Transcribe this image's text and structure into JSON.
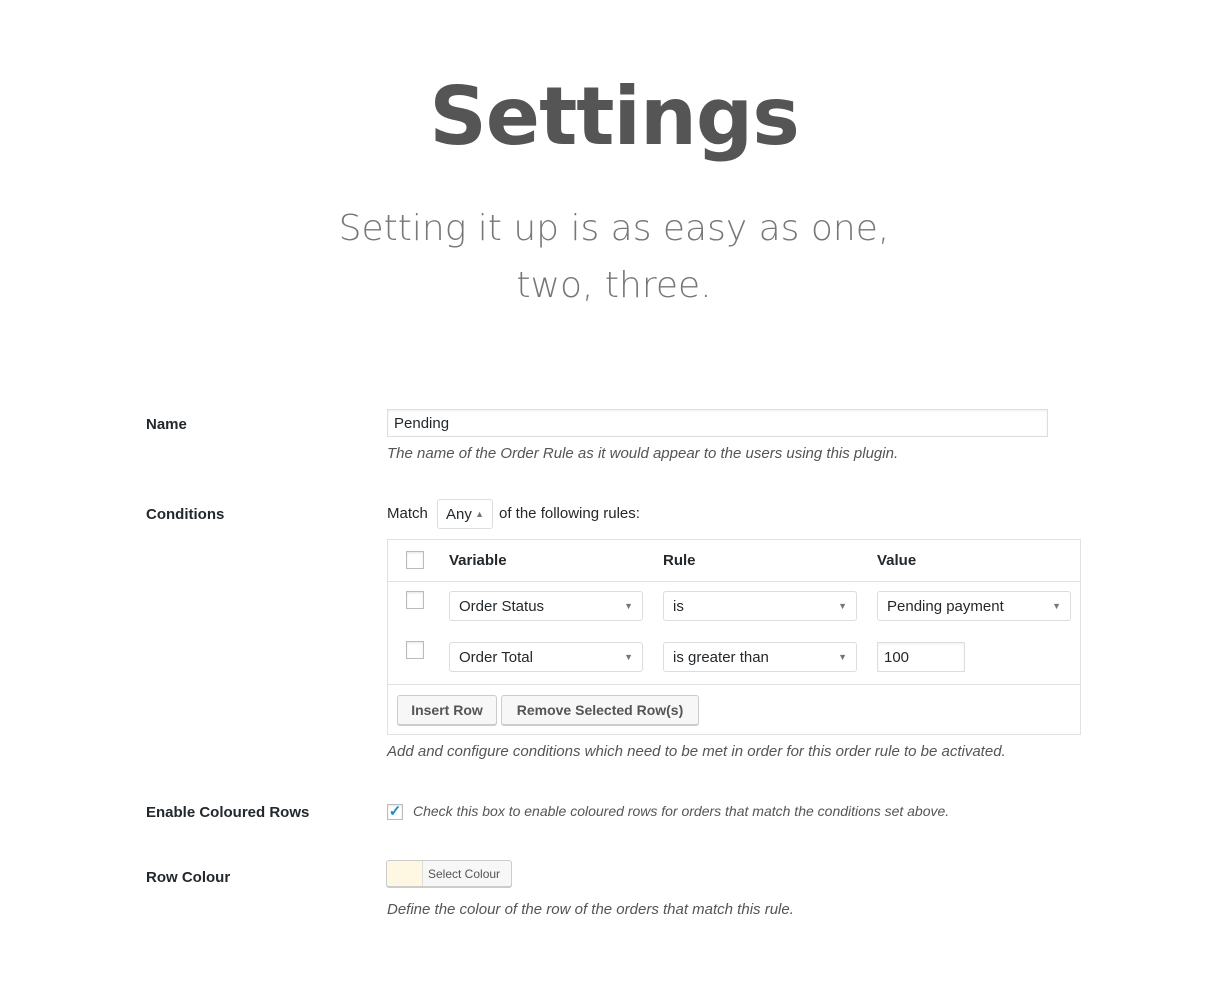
{
  "header": {
    "title": "Settings",
    "subtitle": "Setting it up is as easy as one, two, three."
  },
  "name": {
    "label": "Name",
    "value": "Pending",
    "description": "The name of the Order Rule as it would appear to the users using this plugin."
  },
  "conditions": {
    "label": "Conditions",
    "match_prefix": "Match",
    "match_value": "Any",
    "match_suffix": "of the following rules:",
    "columns": [
      "Variable",
      "Rule",
      "Value"
    ],
    "rows": [
      {
        "variable": "Order Status",
        "rule": "is",
        "value": "Pending payment",
        "value_type": "select"
      },
      {
        "variable": "Order Total",
        "rule": "is greater than",
        "value": "100",
        "value_type": "text"
      }
    ],
    "insert_row": "Insert Row",
    "remove_rows": "Remove Selected Row(s)",
    "description": "Add and configure conditions which need to be met in order for this order rule to be activated."
  },
  "coloured_rows": {
    "label": "Enable Coloured Rows",
    "checked": true,
    "description": "Check this box to enable coloured rows for orders that match the conditions set above."
  },
  "row_colour": {
    "label": "Row Colour",
    "swatch": "#fef7e1",
    "button": "Select Colour",
    "description": "Define the colour of the row of the orders that match this rule."
  }
}
